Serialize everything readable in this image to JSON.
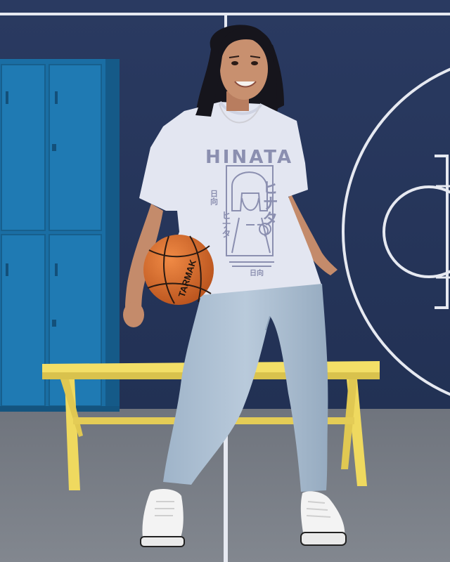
{
  "colors": {
    "wall": "#27375c",
    "floor": "#7b8089",
    "locker": "#1c73a8",
    "bench": "#f1dd64",
    "tshirt": "#e3e6f1",
    "print": "#8b8fb0",
    "jeans": "#a9bdd0",
    "ball": "#d8692a",
    "sneaker": "#f3f3f3",
    "skin": "#c48b6b",
    "hair": "#16151c",
    "court_line": "#e6e9f1"
  },
  "tshirt_print": {
    "title": "HINATA",
    "side_kana": "ヒナタ",
    "left_kana": "ヒナタ",
    "left_kanji": "日向",
    "bottom_kanji": "日向"
  },
  "ball": {
    "brand": "TARMAK"
  }
}
